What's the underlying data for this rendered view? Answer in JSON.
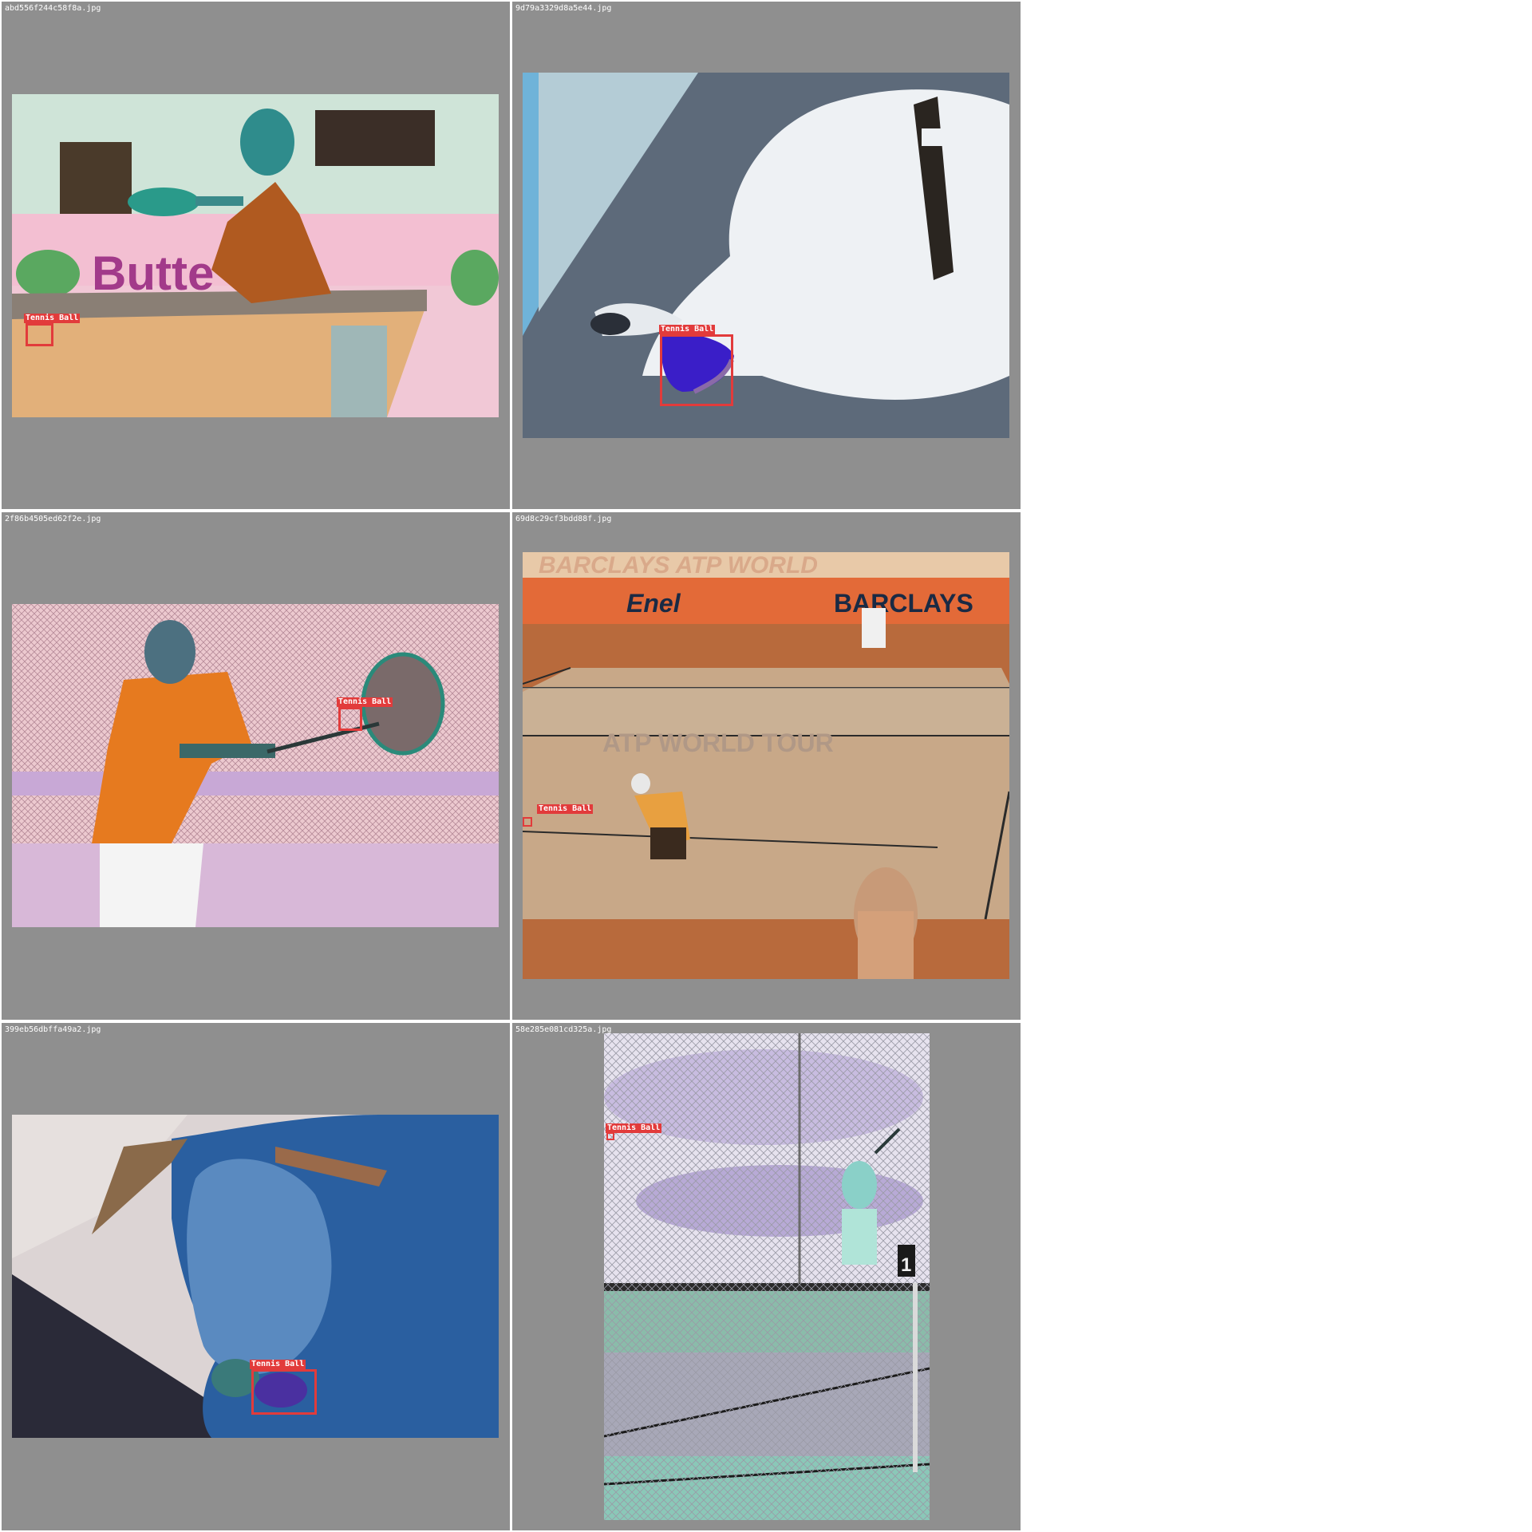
{
  "tiles": [
    {
      "filename": "abd556f244c58f8a.jpg",
      "scene": "table tennis player",
      "detections": [
        {
          "label": "Tennis Ball"
        }
      ]
    },
    {
      "filename": "9d79a3329d8a5e44.jpg",
      "scene": "dog with ball",
      "detections": [
        {
          "label": "Tennis Ball"
        }
      ]
    },
    {
      "filename": "2f86b4505ed62f2e.jpg",
      "scene": "tennis player swinging",
      "detections": [
        {
          "label": "Tennis Ball"
        }
      ]
    },
    {
      "filename": "69d8c29cf3bdd88f.jpg",
      "scene": "clay tennis court",
      "detections": [
        {
          "label": "Tennis Ball"
        }
      ]
    },
    {
      "filename": "399eb56dbffa49a2.jpg",
      "scene": "bulldog with ball",
      "detections": [
        {
          "label": "Tennis Ball"
        }
      ]
    },
    {
      "filename": "58e285e081cd325a.jpg",
      "scene": "tennis court behind fence",
      "detections": [
        {
          "label": "Tennis Ball"
        }
      ]
    }
  ],
  "colors": {
    "tile_background": "#8f8f8f",
    "bbox": "#e23b3b",
    "label_text": "#ffffff"
  }
}
